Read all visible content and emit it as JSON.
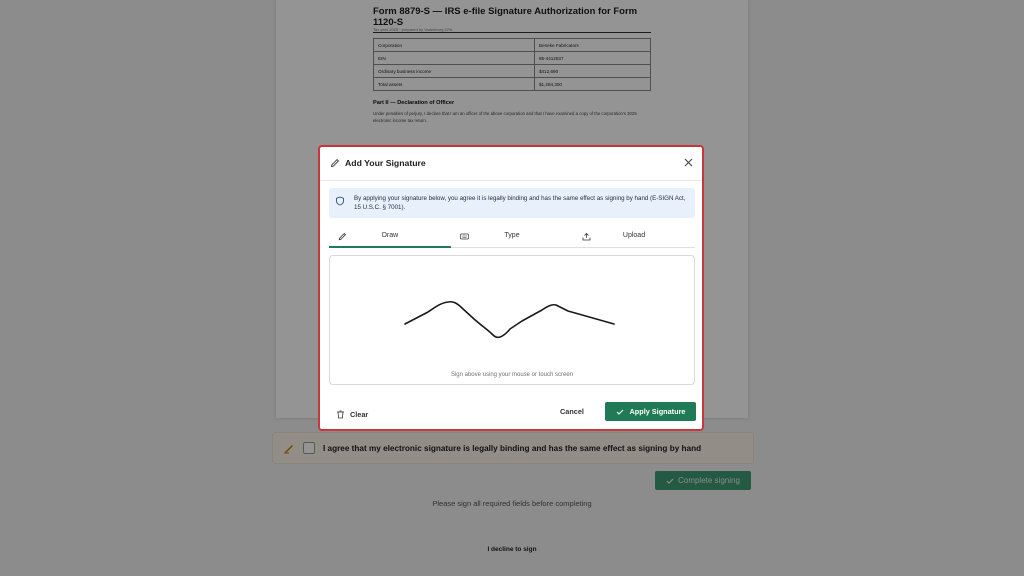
{
  "document": {
    "title": "Form 8879-S — IRS e-file Signature Authorization for Form 1120-S",
    "meta": "Tax year 2025 · prepared by Vadenburg CPA",
    "rows": [
      {
        "label": "Corporation",
        "value": "Beneke Fabricators"
      },
      {
        "label": "EIN",
        "value": "85-4412837"
      },
      {
        "label": "Ordinary business income",
        "value": "$412,690"
      },
      {
        "label": "Total assets",
        "value": "$1,284,300"
      }
    ],
    "section_title": "Part II — Declaration of Officer",
    "section_text": "Under penalties of perjury, I declare that I am an officer of the above corporation and that I have examined a copy of the corporation's 2025 electronic income tax return."
  },
  "agreement": {
    "text": "I agree that my electronic signature is legally binding and has the same effect as signing by hand"
  },
  "footer": {
    "complete_label": "Complete signing",
    "hint": "Please sign all required fields before completing",
    "decline_label": "I decline to sign"
  },
  "modal": {
    "title": "Add Your Signature",
    "legal_text": "By applying your signature below, you agree it is legally binding and has the same effect as signing by hand (E-SIGN Act, 15 U.S.C. § 7001).",
    "tabs": [
      {
        "label": "Draw",
        "icon": "pencil-icon",
        "active": true
      },
      {
        "label": "Type",
        "icon": "keyboard-icon",
        "active": false
      },
      {
        "label": "Upload",
        "icon": "upload-icon",
        "active": false
      }
    ],
    "pad_hint": "Sign above using your mouse or touch screen",
    "clear_label": "Clear",
    "cancel_label": "Cancel",
    "apply_label": "Apply Signature"
  },
  "colors": {
    "accent": "#1f7a55",
    "modal_border": "#c8373c",
    "legal_bg": "#e8f1fb"
  }
}
